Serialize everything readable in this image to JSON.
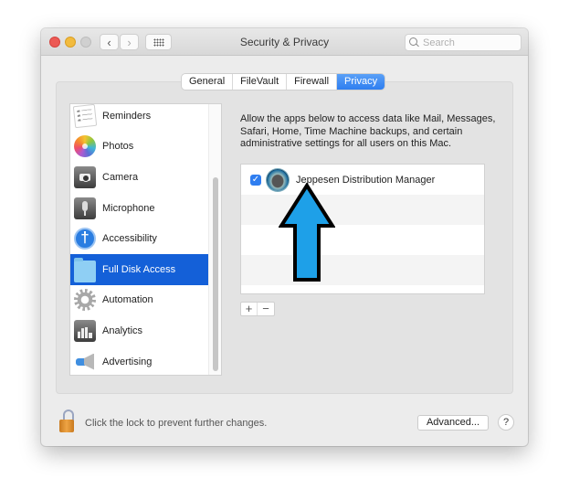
{
  "window": {
    "title": "Security & Privacy",
    "search_placeholder": "Search"
  },
  "toolbar": {
    "back_label": "‹",
    "forward_label": "›"
  },
  "tabs": [
    {
      "label": "General",
      "active": false
    },
    {
      "label": "FileVault",
      "active": false
    },
    {
      "label": "Firewall",
      "active": false
    },
    {
      "label": "Privacy",
      "active": true
    }
  ],
  "sidebar": {
    "items": [
      {
        "label": "Reminders",
        "icon": "reminders-icon",
        "selected": false
      },
      {
        "label": "Photos",
        "icon": "photos-icon",
        "selected": false
      },
      {
        "label": "Camera",
        "icon": "camera-icon",
        "selected": false
      },
      {
        "label": "Microphone",
        "icon": "microphone-icon",
        "selected": false
      },
      {
        "label": "Accessibility",
        "icon": "accessibility-icon",
        "selected": false
      },
      {
        "label": "Full Disk Access",
        "icon": "folder-icon",
        "selected": true
      },
      {
        "label": "Automation",
        "icon": "gear-icon",
        "selected": false
      },
      {
        "label": "Analytics",
        "icon": "analytics-icon",
        "selected": false
      },
      {
        "label": "Advertising",
        "icon": "megaphone-icon",
        "selected": false
      }
    ]
  },
  "privacy": {
    "description": "Allow the apps below to access data like Mail, Messages, Safari, Home, Time Machine backups, and certain administrative settings for all users on this Mac.",
    "apps": [
      {
        "name": "Jeppesen Distribution Manager",
        "checked": true
      }
    ],
    "add_label": "+",
    "remove_label": "−"
  },
  "footer": {
    "lock_text": "Click the lock to prevent further changes.",
    "advanced_label": "Advanced...",
    "help_label": "?"
  },
  "annotation": {
    "arrow_color": "#1ea0e8"
  }
}
